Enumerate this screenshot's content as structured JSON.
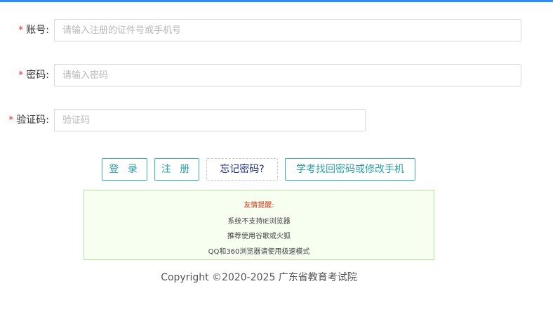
{
  "form": {
    "account": {
      "required_mark": "*",
      "label": "账号:",
      "placeholder": "请输入注册的证件号或手机号",
      "value": ""
    },
    "password": {
      "required_mark": "*",
      "label": "密码:",
      "placeholder": "请输入密码",
      "value": ""
    },
    "captcha": {
      "required_mark": "*",
      "label": "验证码:",
      "placeholder": "验证码",
      "value": ""
    }
  },
  "buttons": {
    "login": "登 录",
    "register": "注 册",
    "forgot_password": "忘记密码?",
    "recover": "学考找回密码或修改手机"
  },
  "notice": {
    "title": "友情提醒:",
    "lines": [
      "系统不支持IE浏览器",
      "推荐使用谷歌或火狐",
      "QQ和360浏览器请使用极速模式"
    ]
  },
  "footer": {
    "copyright": "Copyright ©2020-2025 广东省教育考试院"
  },
  "colors": {
    "top_bar": "#2f8cf5",
    "button_border": "#3bb2b8",
    "notice_border": "#b6e3a1",
    "notice_title": "#d63a1a",
    "required_mark": "#e03b3b"
  }
}
